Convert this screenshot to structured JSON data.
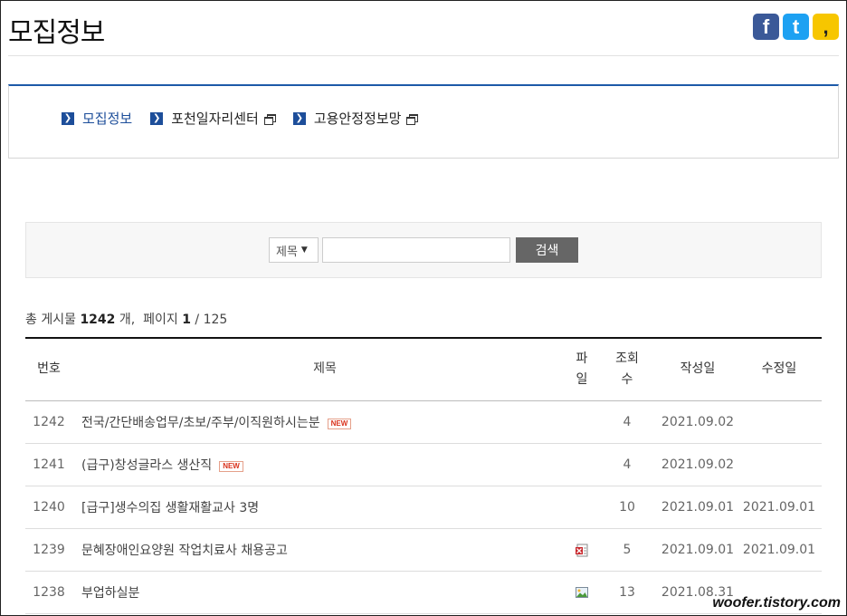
{
  "page": {
    "title": "모집정보"
  },
  "social": {
    "facebook": "f",
    "twitter": "t",
    "kakaostory": ","
  },
  "links": [
    {
      "label": "모집정보",
      "active": true,
      "popup": false
    },
    {
      "label": "포천일자리센터",
      "active": false,
      "popup": true
    },
    {
      "label": "고용안정정보망",
      "active": false,
      "popup": true
    }
  ],
  "search": {
    "field_value": "제목",
    "query_value": "",
    "button_label": "검색"
  },
  "summary": {
    "total_prefix": "총 게시물",
    "total_count": "1242",
    "total_suffix": "개,",
    "page_prefix": "페이지",
    "current_page": "1",
    "page_sep": "/ 125"
  },
  "table": {
    "headers": {
      "num": "번호",
      "title": "제목",
      "file_line1": "파",
      "file_line2": "일",
      "views_line1": "조회",
      "views_line2": "수",
      "date": "작성일",
      "modified": "수정일"
    },
    "new_label": "NEW",
    "rows": [
      {
        "num": "1242",
        "title": "전국/간단배송업무/초보/주부/이직원하시는분",
        "new": true,
        "file": "",
        "views": "4",
        "date": "2021.09.02",
        "modified": ""
      },
      {
        "num": "1241",
        "title": "(급구)창성글라스 생산직",
        "new": true,
        "file": "",
        "views": "4",
        "date": "2021.09.02",
        "modified": ""
      },
      {
        "num": "1240",
        "title": "[급구]생수의집 생활재활교사 3명",
        "new": false,
        "file": "",
        "views": "10",
        "date": "2021.09.01",
        "modified": "2021.09.01"
      },
      {
        "num": "1239",
        "title": "문혜장애인요양원 작업치료사 채용공고",
        "new": false,
        "file": "document-icon",
        "views": "5",
        "date": "2021.09.01",
        "modified": "2021.09.01"
      },
      {
        "num": "1238",
        "title": "부업하실분",
        "new": false,
        "file": "image-icon",
        "views": "13",
        "date": "2021.08.31",
        "modified": ""
      }
    ]
  },
  "watermark": "woofer.tistory.com",
  "colors": {
    "accent": "#1d4e9a",
    "new_badge": "#d9321c",
    "search_button": "#666666"
  }
}
